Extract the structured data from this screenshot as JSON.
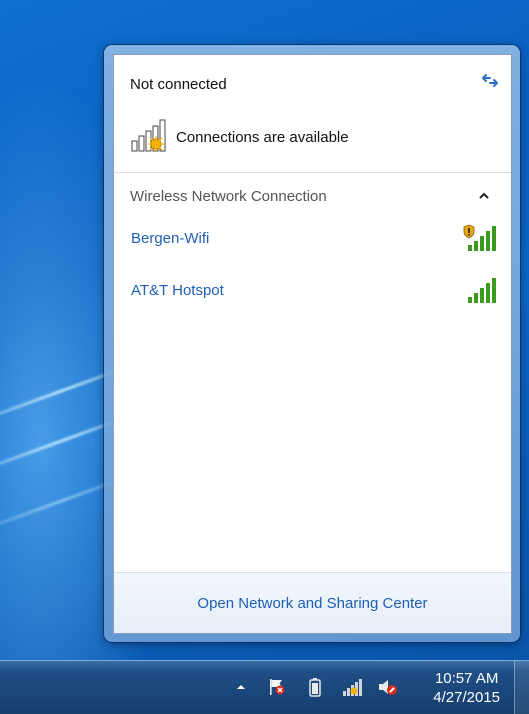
{
  "flyout": {
    "status_title": "Not connected",
    "connections_text": "Connections are available",
    "refresh_icon": "refresh-arrows-icon",
    "section_title": "Wireless Network Connection",
    "collapse_icon": "chevron-up-icon",
    "networks": [
      {
        "name": "Bergen-Wifi",
        "signal_bars": 5,
        "secured": true,
        "signal_icon": "wifi-signal-shield-icon"
      },
      {
        "name": "AT&T Hotspot",
        "signal_bars": 5,
        "secured": false,
        "signal_icon": "wifi-signal-icon"
      }
    ],
    "footer_link": "Open Network and Sharing Center"
  },
  "taskbar": {
    "tray_icons": [
      "show-hidden-icons-arrow",
      "action-center-flag-icon",
      "battery-icon",
      "network-status-icon",
      "volume-muted-icon"
    ],
    "clock": {
      "time": "10:57 AM",
      "date": "4/27/2015"
    }
  },
  "colors": {
    "link": "#1e5fb4",
    "signal_green": "#3c9a1e",
    "desktop_blue": "#0a5fb8"
  }
}
